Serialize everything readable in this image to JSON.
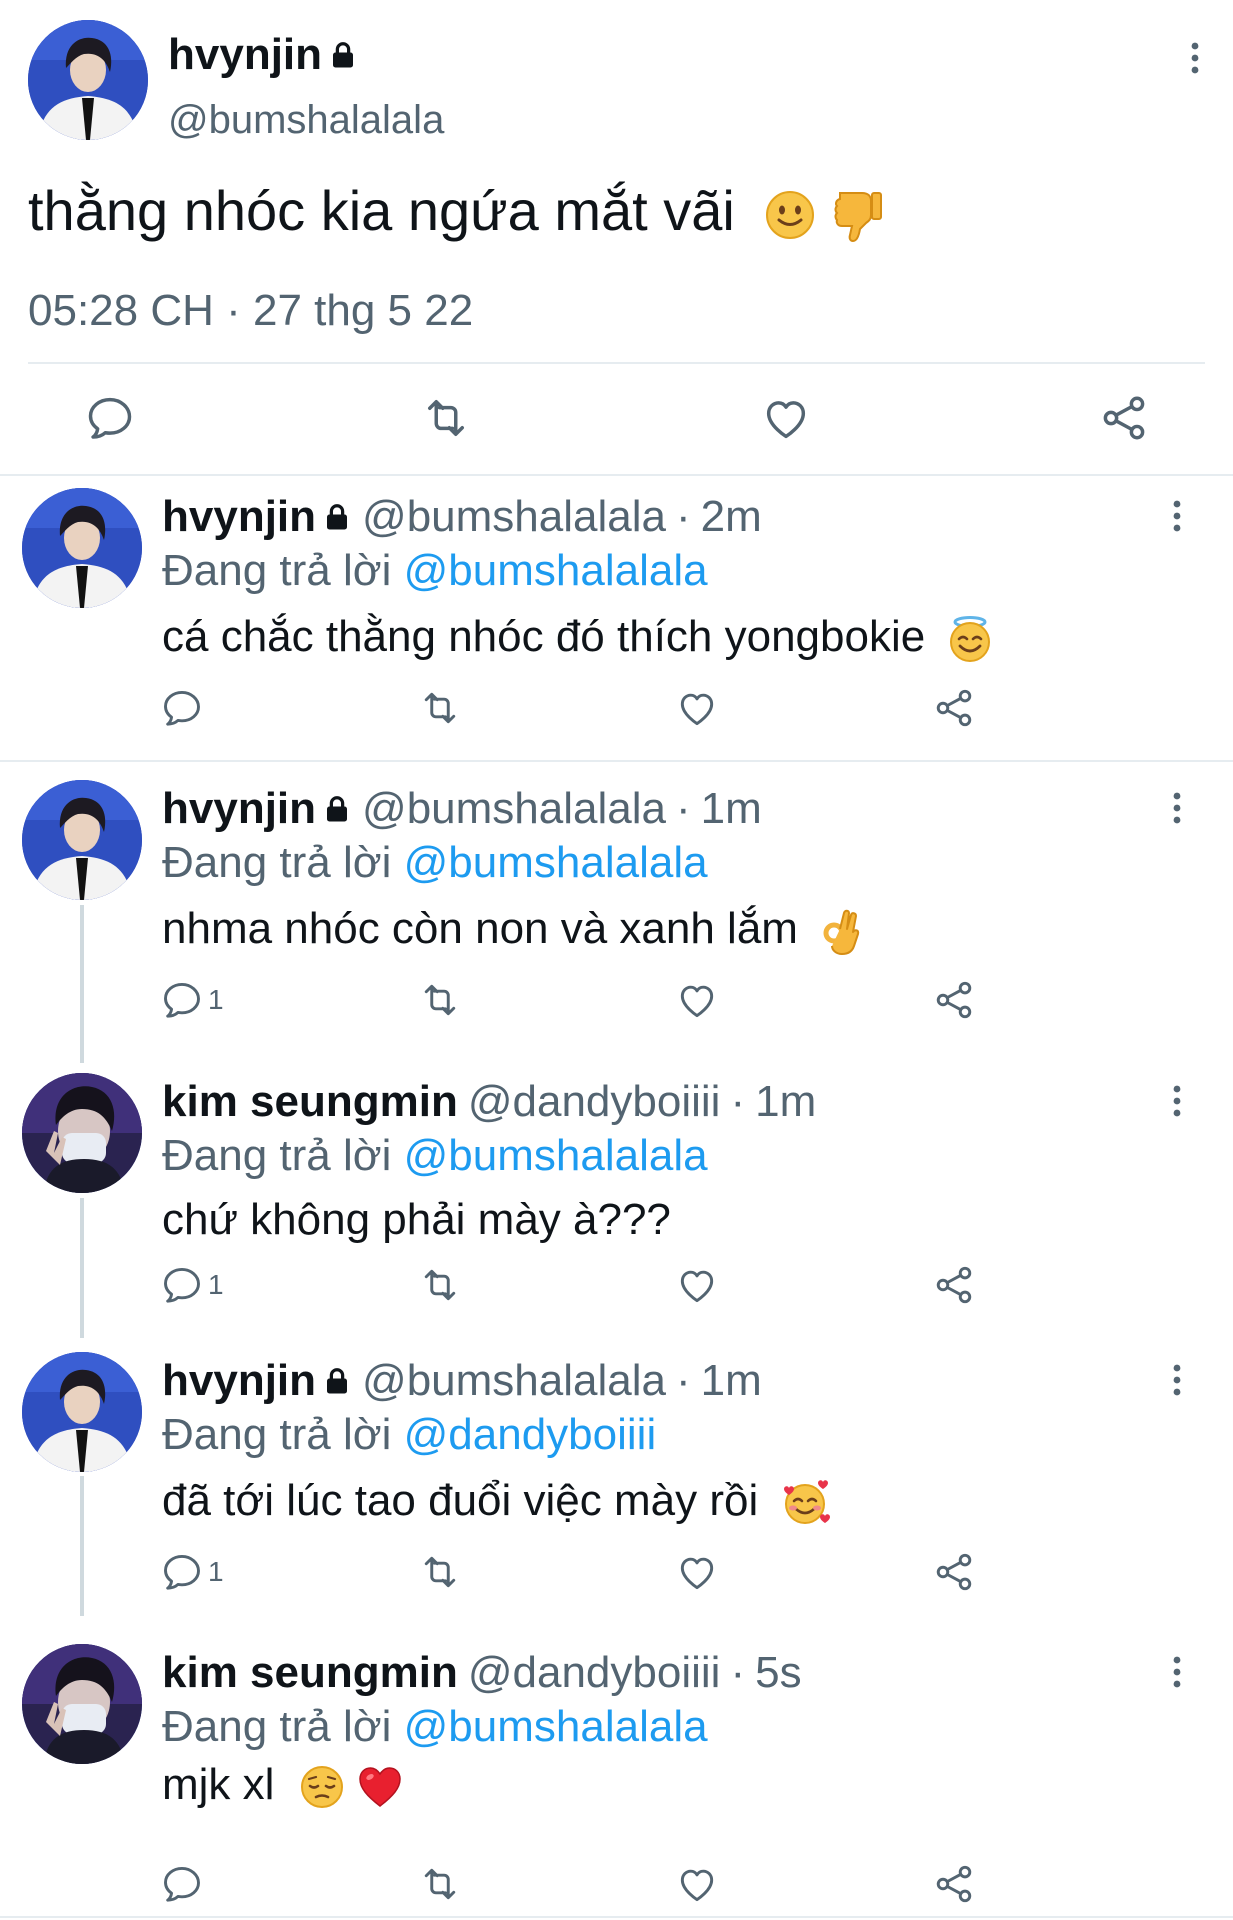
{
  "main_tweet": {
    "name": "hvynjin",
    "handle": "@bumshalalala",
    "text": "thằng nhóc kia ngứa mắt vãi",
    "timestamp": "05:28 CH · 27 thg 5 22",
    "emojis": [
      "slightly-smiling-face",
      "thumbs-down"
    ]
  },
  "replies": [
    {
      "name": "hvynjin",
      "locked": true,
      "handle": "@bumshalalala",
      "sep": "·",
      "ago": "2m",
      "replying_prefix": "Đang trả lời ",
      "replying_to": "@bumshalalala",
      "text": "cá chắc thằng nhóc đó thích yongbokie",
      "emoji": "smiling-face-with-halo",
      "reply_count": ""
    },
    {
      "name": "hvynjin",
      "locked": true,
      "handle": "@bumshalalala",
      "sep": "·",
      "ago": "1m",
      "replying_prefix": "Đang trả lời ",
      "replying_to": "@bumshalalala",
      "text": "nhma nhóc còn non và xanh lắm",
      "emoji": "ok-hand",
      "reply_count": "1"
    },
    {
      "name": "kim seungmin",
      "locked": false,
      "handle": "@dandyboiiii",
      "sep": "·",
      "ago": "1m",
      "replying_prefix": "Đang trả lời ",
      "replying_to": "@bumshalalala",
      "text": "chứ không phải mày à???",
      "emoji": "",
      "reply_count": "1"
    },
    {
      "name": "hvynjin",
      "locked": true,
      "handle": "@bumshalalala",
      "sep": "·",
      "ago": "1m",
      "replying_prefix": "Đang trả lời ",
      "replying_to": "@dandyboiiii",
      "text": "đã tới lúc tao đuổi việc mày rồi",
      "emoji": "smiling-face-with-hearts",
      "reply_count": "1"
    },
    {
      "name": "kim seungmin",
      "locked": false,
      "handle": "@dandyboiiii",
      "sep": "·",
      "ago": "5s",
      "replying_prefix": "Đang trả lời ",
      "replying_to": "@bumshalalala",
      "text": "mjk xl",
      "emoji": "pensive-face red-heart",
      "reply_count": ""
    }
  ],
  "colors": {
    "text": "#0f1419",
    "muted": "#536471",
    "accent": "#1d9bf0",
    "divider": "#e6ecf0"
  }
}
